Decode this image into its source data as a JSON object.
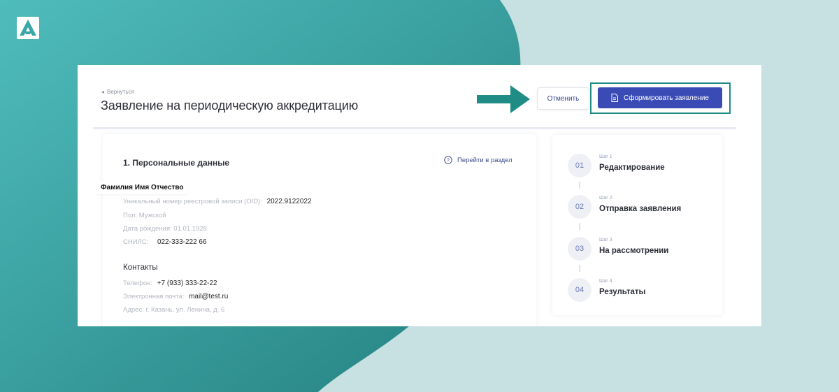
{
  "header": {
    "back_label": "Вернуться",
    "title": "Заявление на периодическую аккредитацию",
    "cancel_label": "Отменить",
    "submit_label": "Сформировать заявление"
  },
  "personal": {
    "title": "1. Персональные данные",
    "goto_label": "Перейти в раздел",
    "full_name": "Фамилия Имя Отчество",
    "oid_label": "Уникальный номер реестровой записи (OID):",
    "oid_value": "2022.9122022",
    "gender": "Пол: Мужской",
    "birth_date": "Дата рождения: 01.01.1928",
    "snils_label": "СНИЛС:",
    "snils_value": "022-333-222 66"
  },
  "contacts": {
    "title": "Контакты",
    "phone_label": "Телефон:",
    "phone_value": "+7 (933) 333-22-22",
    "email_label": "Электронная почта:",
    "email_value": "mail@test.ru",
    "address": "Адрес: г. Казань, ул. Ленина, д. 6"
  },
  "steps": [
    {
      "num": "01",
      "step": "Шаг 1",
      "name": "Редактирование"
    },
    {
      "num": "02",
      "step": "Шаг 2",
      "name": "Отправка заявления"
    },
    {
      "num": "03",
      "step": "Шаг 3",
      "name": "На рассмотрении"
    },
    {
      "num": "04",
      "step": "Шаг 4",
      "name": "Результаты"
    }
  ],
  "colors": {
    "teal_dark": "#2f9a9b",
    "teal_light": "#c7e1e2",
    "primary": "#3a4bb5",
    "arrow": "#1f8c86"
  },
  "icons": [
    "logo-icon",
    "chevron-left-icon",
    "document-icon",
    "question-circle-icon",
    "arrow-right-icon"
  ]
}
